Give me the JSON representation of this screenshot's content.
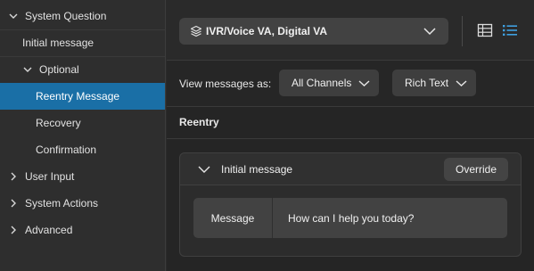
{
  "sidebar": {
    "items": [
      {
        "label": "System Question",
        "level": 0,
        "chevron": "chevron-down-icon",
        "active": false
      },
      {
        "label": "Initial message",
        "level": 1,
        "chevron": null,
        "active": false
      },
      {
        "label": "Optional",
        "level": 1,
        "chevron": "chevron-down-icon",
        "active": false
      },
      {
        "label": "Reentry Message",
        "level": 2,
        "chevron": null,
        "active": true
      },
      {
        "label": "Recovery",
        "level": 2,
        "chevron": null,
        "active": false
      },
      {
        "label": "Confirmation",
        "level": 2,
        "chevron": null,
        "active": false
      },
      {
        "label": "User Input",
        "level": 0,
        "chevron": "chevron-right-icon",
        "active": false
      },
      {
        "label": "System Actions",
        "level": 0,
        "chevron": "chevron-right-icon",
        "active": false
      },
      {
        "label": "Advanced",
        "level": 0,
        "chevron": "chevron-right-icon",
        "active": false
      }
    ]
  },
  "header": {
    "channel_select": {
      "value": "IVR/Voice VA, Digital VA",
      "icon": "layers-icon"
    },
    "view_toggle": {
      "table_icon": "table-view-icon",
      "list_icon": "list-view-icon",
      "selected": "list"
    }
  },
  "viewbar": {
    "label": "View messages as:",
    "channels_label": "All Channels",
    "format_label": "Rich Text"
  },
  "section": {
    "title": "Reentry"
  },
  "card": {
    "title": "Initial message",
    "override_label": "Override",
    "message_label": "Message",
    "message_value": "How can I help you today?"
  },
  "colors": {
    "accent": "#1a6fa6",
    "active_icon": "#3fa0e0",
    "background": "#252525"
  }
}
